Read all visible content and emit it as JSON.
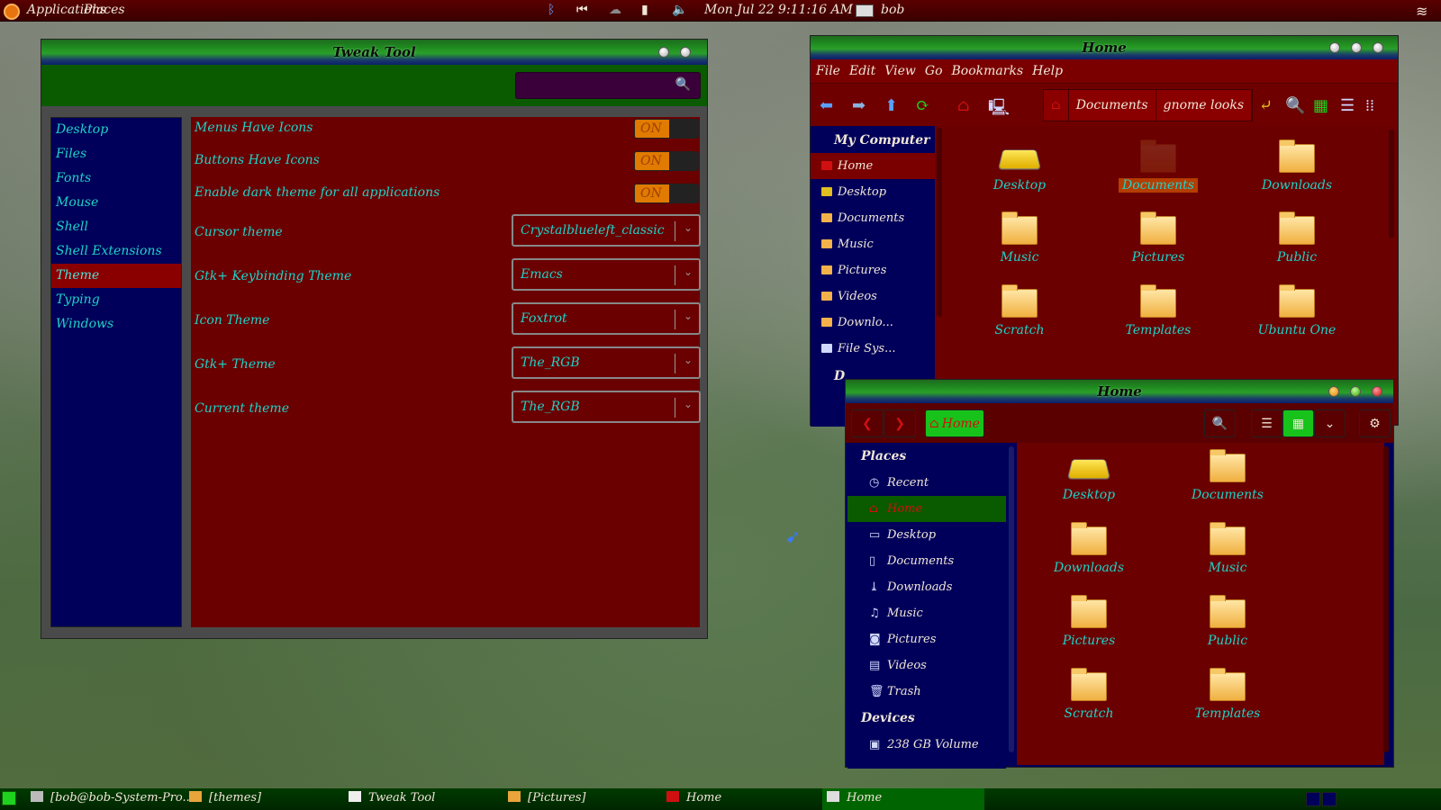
{
  "top_panel": {
    "apps_label": "Applications",
    "places_label": "Places",
    "clock": "Mon Jul 22   9:11:16 AM",
    "user": "bob"
  },
  "tweak_tool": {
    "title": "Tweak Tool",
    "sidebar": [
      "Desktop",
      "Files",
      "Fonts",
      "Mouse",
      "Shell",
      "Shell Extensions",
      "Theme",
      "Typing",
      "Windows"
    ],
    "toggles": [
      {
        "label": "Menus Have Icons",
        "state": "ON"
      },
      {
        "label": "Buttons Have Icons",
        "state": "ON"
      },
      {
        "label": "Enable dark theme for all applications",
        "state": "ON"
      }
    ],
    "combos": [
      {
        "label": "Cursor theme",
        "value": "Crystalblueleft_classic"
      },
      {
        "label": "Gtk+ Keybinding Theme",
        "value": "Emacs"
      },
      {
        "label": "Icon Theme",
        "value": "Foxtrot"
      },
      {
        "label": "Gtk+ Theme",
        "value": "The_RGB"
      },
      {
        "label": "Current theme",
        "value": "The_RGB"
      }
    ]
  },
  "file_manager_1": {
    "title": "Home",
    "menu": [
      "File",
      "Edit",
      "View",
      "Go",
      "Bookmarks",
      "Help"
    ],
    "breadcrumbs": [
      "Documents",
      "gnome looks"
    ],
    "sidebar_heading": "My Computer",
    "sidebar_items": [
      "Home",
      "Desktop",
      "Documents",
      "Music",
      "Pictures",
      "Videos",
      "Downlo...",
      "File Sys..."
    ],
    "second_heading": "D",
    "files": [
      "Desktop",
      "Documents",
      "Downloads",
      "Music",
      "Pictures",
      "Public",
      "Scratch",
      "Templates",
      "Ubuntu One"
    ]
  },
  "file_manager_2": {
    "title": "Home",
    "home_button": "Home",
    "places_heading": "Places",
    "places": [
      "Recent",
      "Home",
      "Desktop",
      "Documents",
      "Downloads",
      "Music",
      "Pictures",
      "Videos",
      "Trash"
    ],
    "devices_heading": "Devices",
    "devices": [
      "238 GB Volume"
    ],
    "files": [
      "Desktop",
      "Documents",
      "Downloads",
      "Music",
      "Pictures",
      "Public",
      "Scratch",
      "Templates"
    ]
  },
  "taskbar": [
    "[bob@bob-System-Pro...",
    "[themes]",
    "Tweak Tool",
    "[Pictures]",
    "Home",
    "Home"
  ],
  "colors": {
    "panel_red": "#5a0000",
    "window_red": "#6a0000",
    "sidebar_blue": "#00005a",
    "accent_cyan": "#1fd2c8",
    "toggle_orange": "#e07a00",
    "green": "#0a5a00"
  }
}
